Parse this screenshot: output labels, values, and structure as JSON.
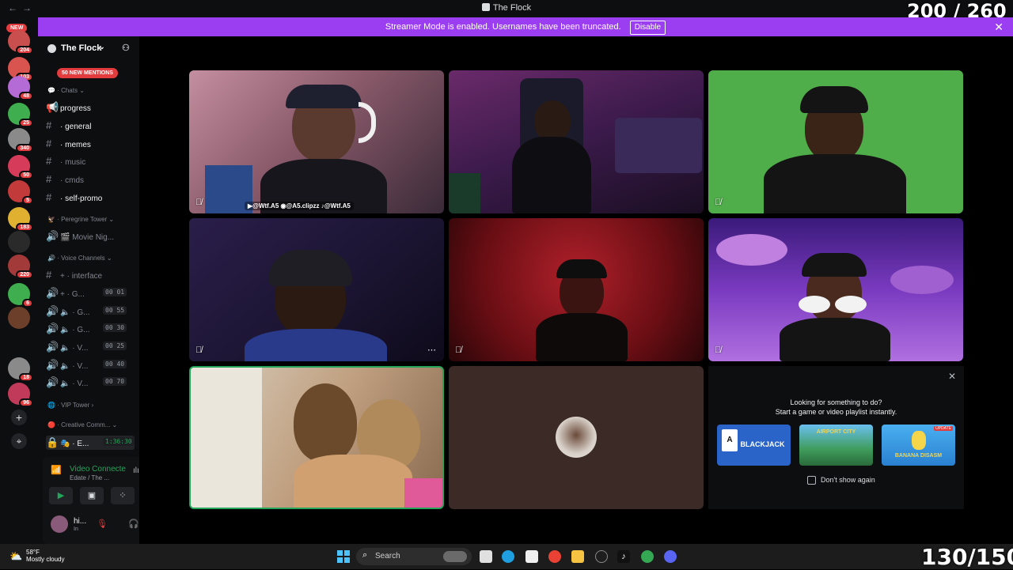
{
  "window": {
    "title": "The Flock",
    "back_glyph": "←",
    "forward_glyph": "→"
  },
  "overlays": {
    "top_counter": "200 / 260",
    "bottom_counter": "130/150"
  },
  "streamer_banner": {
    "message": "Streamer Mode is enabled. Usernames have been truncated.",
    "disable_label": "Disable",
    "close_glyph": "✕",
    "color": "#9b3df0"
  },
  "server_rail": {
    "new_label": "NEW",
    "servers": [
      {
        "badge": "204",
        "color": "#c94f4f"
      },
      {
        "badge": "103",
        "color": "#d9534f"
      },
      {
        "badge": "48",
        "color": "#b56bd6"
      },
      {
        "badge": "25",
        "color": "#3fae4f"
      },
      {
        "badge": "340",
        "color": "#8a8a8a"
      },
      {
        "badge": "50",
        "color": "#d63c5a"
      },
      {
        "badge": "5",
        "color": "#c23a3a"
      },
      {
        "badge": "183",
        "color": "#e0b030"
      },
      {
        "badge": "",
        "color": "#2a2a2a"
      },
      {
        "badge": "220",
        "color": "#a23a3a"
      },
      {
        "badge": "6",
        "color": "#3fae4f"
      },
      {
        "badge": "",
        "color": "#6b3f2a"
      },
      {
        "badge": "",
        "color": "#0d0e10"
      },
      {
        "badge": "18",
        "color": "#8a8a8a"
      },
      {
        "badge": "96",
        "color": "#c23a5a"
      }
    ],
    "add_glyph": "+",
    "discover_glyph": "⌖"
  },
  "sidebar": {
    "guild_name": "The Flock",
    "mentions_label": "50 NEW MENTIONS",
    "categories": {
      "chats": "Chats",
      "peregrine": "Peregrine Tower",
      "voice": "Voice Channels",
      "vip": "VIP Tower",
      "creative": "Creative Comm..."
    },
    "channels": {
      "progress": "progress",
      "general": "general",
      "memes": "memes",
      "music": "music",
      "cmds": "cmds",
      "self_promo": "self-promo",
      "movie_night": "Movie Nig...",
      "interface": "interface",
      "g1": "G...",
      "g2": "G...",
      "g3": "G...",
      "v1": "V...",
      "v2": "V...",
      "v3": "V...",
      "e1": "E..."
    },
    "timers": {
      "g1": "00 01",
      "g2": "00 55",
      "g3": "00 30",
      "v1": "00 25",
      "v2": "00 40",
      "v3": "00 70",
      "e1": "1:36:30"
    }
  },
  "voice_panel": {
    "status": "Video Connecte",
    "subtext": "Edate / The ...",
    "username": "hi...",
    "user_sub": "In"
  },
  "video_grid": {
    "social_banner": "▶@Wtf.A5 ◉@A5.clipzz ♪@Wtf.A5"
  },
  "activity": {
    "title_line1": "Looking for something to do?",
    "title_line2": "Start a game or video playlist instantly.",
    "close_glyph": "✕",
    "games": [
      {
        "name": "BLACKJACK",
        "color": "#2a64c9"
      },
      {
        "name": "AIRPORT CITY",
        "color": "#3f9c5c"
      },
      {
        "name": "BANANA DISASM",
        "color": "#3aa0e0"
      }
    ],
    "update_badge": "UPDATE",
    "dont_show": "Don't show again"
  },
  "taskbar": {
    "temperature": "58°F",
    "condition": "Mostly cloudy",
    "search_placeholder": "Search"
  }
}
